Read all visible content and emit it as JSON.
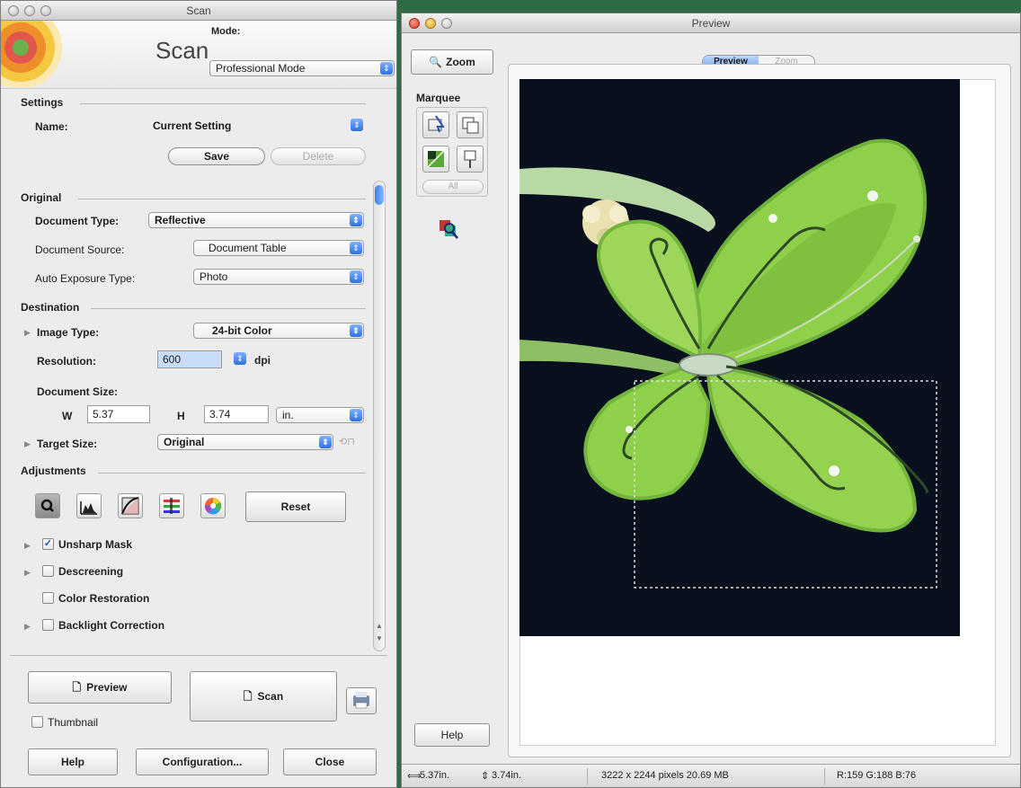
{
  "scan_window": {
    "title": "Scan",
    "app_label": "Scan",
    "mode_label": "Mode:",
    "mode_value": "Professional Mode",
    "settings_heading": "Settings",
    "name_label": "Name:",
    "name_value": "Current Setting",
    "save_label": "Save",
    "delete_label": "Delete",
    "original_heading": "Original",
    "doc_type_label": "Document Type:",
    "doc_type_value": "Reflective",
    "doc_source_label": "Document Source:",
    "doc_source_value": "Document Table",
    "auto_exposure_label": "Auto Exposure Type:",
    "auto_exposure_value": "Photo",
    "destination_heading": "Destination",
    "image_type_label": "Image Type:",
    "image_type_value": "24-bit Color",
    "resolution_label": "Resolution:",
    "resolution_value": "600",
    "resolution_unit": "dpi",
    "doc_size_label": "Document Size:",
    "w_label": "W",
    "w_value": "5.37",
    "h_label": "H",
    "h_value": "3.74",
    "size_unit": "in.",
    "target_size_label": "Target Size:",
    "target_size_value": "Original",
    "adjustments_heading": "Adjustments",
    "reset_label": "Reset",
    "unsharp_label": "Unsharp Mask",
    "unsharp_checked": true,
    "descreening_label": "Descreening",
    "color_restoration_label": "Color Restoration",
    "backlight_label": "Backlight Correction",
    "preview_label": "Preview",
    "scan_label": "Scan",
    "thumbnail_label": "Thumbnail",
    "help_label": "Help",
    "configuration_label": "Configuration...",
    "close_label": "Close"
  },
  "preview_window": {
    "title": "Preview",
    "zoom_button_label": "Zoom",
    "marquee_label": "Marquee",
    "all_label": "All",
    "tab_preview": "Preview",
    "tab_zoom": "Zoom",
    "help_label": "Help",
    "status_width": "5.37in.",
    "status_height": "3.74in.",
    "status_pixels": "3222 x 2244 pixels 20.69 MB",
    "status_rgb": "R:159 G:188 B:76"
  },
  "colors": {
    "accent": "#2f6fe0",
    "preview_bg": "#08101d",
    "wing": "#8fd04a"
  }
}
